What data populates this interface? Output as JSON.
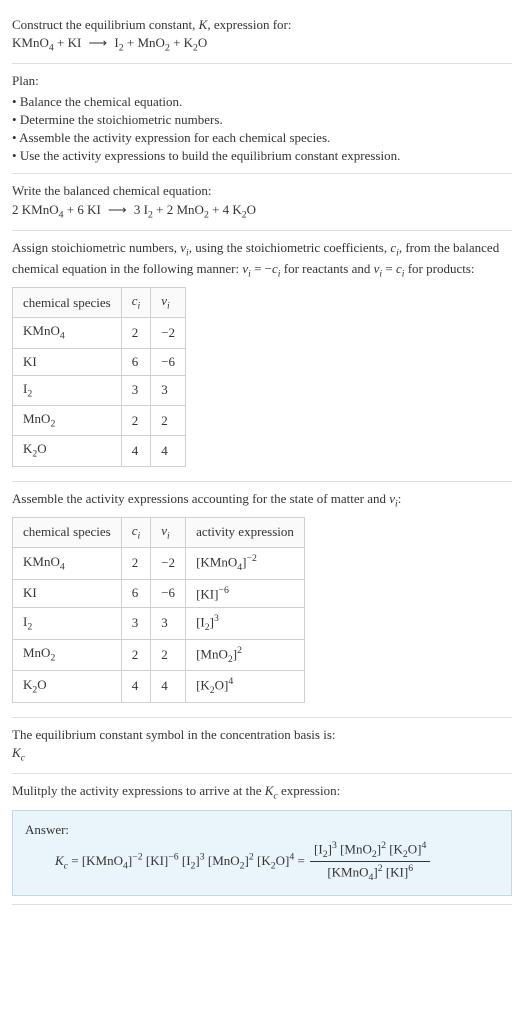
{
  "header": {
    "line1": "Construct the equilibrium constant, ",
    "K": "K",
    "line1b": ", expression for:",
    "lhs1": "KMnO",
    "lhs1sub": "4",
    "plus": " + ",
    "lhs2": "KI",
    "arrow": "⟶",
    "rhs1": "I",
    "rhs1sub": "2",
    "rhs2": "MnO",
    "rhs2sub": "2",
    "rhs3": "K",
    "rhs3sub": "2",
    "rhs3b": "O"
  },
  "plan": {
    "title": "Plan:",
    "items": [
      "Balance the chemical equation.",
      "Determine the stoichiometric numbers.",
      "Assemble the activity expression for each chemical species.",
      "Use the activity expressions to build the equilibrium constant expression."
    ]
  },
  "balanced": {
    "title": "Write the balanced chemical equation:",
    "c1": "2 ",
    "s1": "KMnO",
    "s1sub": "4",
    "c2": "6 ",
    "s2": "KI",
    "c3": "3 ",
    "s3": "I",
    "s3sub": "2",
    "c4": "2 ",
    "s4": "MnO",
    "s4sub": "2",
    "c5": "4 ",
    "s5": "K",
    "s5sub": "2",
    "s5b": "O"
  },
  "assign": {
    "text1": "Assign stoichiometric numbers, ",
    "nu": "ν",
    "sub_i": "i",
    "text2": ", using the stoichiometric coefficients, ",
    "ci": "c",
    "text3": ", from the balanced chemical equation in the following manner: ",
    "eq1": " = −",
    "eq2": " for reactants and ",
    "eq3": " = ",
    "eq4": " for products:"
  },
  "table1": {
    "h1": "chemical species",
    "h2": "c",
    "h2sub": "i",
    "h3": "ν",
    "h3sub": "i",
    "rows": [
      {
        "sp": "KMnO",
        "spsub": "4",
        "c": "2",
        "nu": "−2"
      },
      {
        "sp": "KI",
        "spsub": "",
        "c": "6",
        "nu": "−6"
      },
      {
        "sp": "I",
        "spsub": "2",
        "c": "3",
        "nu": "3"
      },
      {
        "sp": "MnO",
        "spsub": "2",
        "c": "2",
        "nu": "2"
      },
      {
        "sp": "K",
        "spsub": "2",
        "spb": "O",
        "c": "4",
        "nu": "4"
      }
    ]
  },
  "assemble": {
    "text": "Assemble the activity expressions accounting for the state of matter and "
  },
  "table2": {
    "h4": "activity expression",
    "rows": [
      {
        "sp": "KMnO",
        "spsub": "4",
        "c": "2",
        "nu": "−2",
        "act": "[KMnO",
        "actsub": "4",
        "actsup": "−2"
      },
      {
        "sp": "KI",
        "spsub": "",
        "c": "6",
        "nu": "−6",
        "act": "[KI]",
        "actsub": "",
        "actsup": "−6"
      },
      {
        "sp": "I",
        "spsub": "2",
        "c": "3",
        "nu": "3",
        "act": "[I",
        "actsub": "2",
        "actsup": "3"
      },
      {
        "sp": "MnO",
        "spsub": "2",
        "c": "2",
        "nu": "2",
        "act": "[MnO",
        "actsub": "2",
        "actsup": "2"
      },
      {
        "sp": "K",
        "spsub": "2",
        "spb": "O",
        "c": "4",
        "nu": "4",
        "act": "[K",
        "actsub": "2",
        "actb": "O]",
        "actsup": "4"
      }
    ]
  },
  "symbol": {
    "text": "The equilibrium constant symbol in the concentration basis is:",
    "kc": "K",
    "kcsub": "c"
  },
  "multiply": {
    "text1": "Mulitply the activity expressions to arrive at the ",
    "text2": " expression:"
  },
  "answer": {
    "label": "Answer:",
    "kc": "K",
    "kcsub": "c",
    "eq": " = ",
    "t1": "[KMnO",
    "t1sub": "4",
    "t1sup": "−2",
    "t2": "[KI]",
    "t2sup": "−6",
    "t3": "[I",
    "t3sub": "2",
    "t3sup": "3",
    "t4": "[MnO",
    "t4sub": "2",
    "t4sup": "2",
    "t5": "[K",
    "t5sub": "2",
    "t5b": "O]",
    "t5sup": "4",
    "num1": "[I",
    "num1sub": "2",
    "num1sup": "3",
    "num2": "[MnO",
    "num2sub": "2",
    "num2sup": "2",
    "num3": "[K",
    "num3sub": "2",
    "num3b": "O]",
    "num3sup": "4",
    "den1": "[KMnO",
    "den1sub": "4",
    "den1sup": "2",
    "den2": "[KI]",
    "den2sup": "6"
  }
}
